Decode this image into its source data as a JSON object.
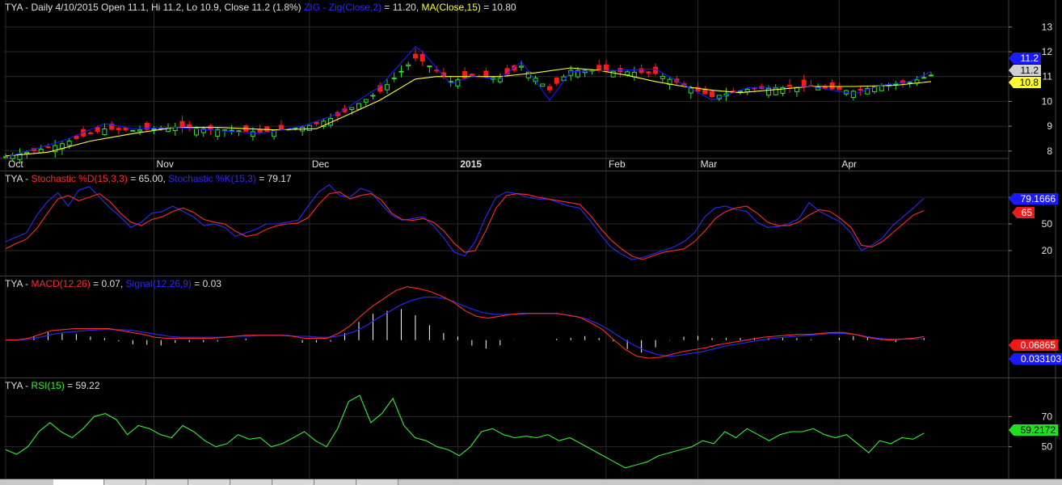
{
  "colors": {
    "bg": "#000000",
    "grid": "#2a2a2a",
    "sep": "#404040",
    "candle_up": "#33dd33",
    "candle_down": "#ff1a1a",
    "zig": "#1a1aff",
    "ma": "#ffff33",
    "stoch_d": "#ff2a2a",
    "stoch_k": "#2a2aff",
    "macd": "#ff2a2a",
    "signal": "#2a2aff",
    "hist": "#ffffff",
    "rsi": "#33ee33",
    "text": "#e0e0e0"
  },
  "price": {
    "ticker": "TYA",
    "header": " - Daily 4/10/2015 Open 11.1, Hi 11.2, Lo 10.9, Close 11.2 (1.8%)",
    "zig_label": "ZIG - Zig(Close,2)",
    "zig_value": " = 11.20, ",
    "ma_label": "MA(Close,15)",
    "ma_value": " = 10.80",
    "y_ticks": [
      "13",
      "12",
      "11",
      "10",
      "9",
      "8"
    ],
    "badge_zig": "11.2",
    "badge_close": "11.2",
    "badge_ma": "10.8",
    "x_labels": [
      {
        "t": "Oct",
        "d": 0,
        "bold": false
      },
      {
        "t": "Nov",
        "d": 21,
        "bold": false
      },
      {
        "t": "Dec",
        "d": 43,
        "bold": false
      },
      {
        "t": "2015",
        "d": 64,
        "bold": true
      },
      {
        "t": "Feb",
        "d": 85,
        "bold": false
      },
      {
        "t": "Mar",
        "d": 98,
        "bold": false
      },
      {
        "t": "Apr",
        "d": 118,
        "bold": false
      }
    ]
  },
  "stoch": {
    "ticker": "TYA",
    "d_label": "Stochastic %D(15,3,3)",
    "d_value": " = 65.00, ",
    "k_label": "Stochastic %K(15,3)",
    "k_value": " = 79.17",
    "y_ticks": [
      "80",
      "50",
      "20"
    ],
    "badge_k": "79.1666",
    "badge_d": "65"
  },
  "macd": {
    "ticker": "TYA",
    "macd_label": "MACD(12,26)",
    "macd_value": " = 0.07, ",
    "signal_label": "Signal(12,26,9)",
    "signal_value": " = 0.03",
    "badge_macd": "0.06865",
    "badge_signal": "0.033103"
  },
  "rsi": {
    "ticker": "TYA",
    "label": "RSI(15)",
    "value": " = 59.22",
    "y_ticks": [
      "70",
      "50"
    ],
    "badge": "59.2172"
  },
  "chart_data": [
    {
      "type": "candlestick",
      "title": "TYA - Daily 4/10/2015 Open 11.1, Hi 11.2, Lo 10.9, Close 11.2 (1.8%)",
      "x_range": [
        "2014-09-29",
        "2015-04-10"
      ],
      "ylim": [
        7.7,
        13.5
      ],
      "series": [
        {
          "name": "ZIG - Zig(Close,2)",
          "points": [
            [
              0,
              7.75
            ],
            [
              8,
              8.4
            ],
            [
              14,
              9.1
            ],
            [
              18,
              8.9
            ],
            [
              24,
              8.95
            ],
            [
              36,
              8.7
            ],
            [
              42,
              9.0
            ],
            [
              47,
              9.5
            ],
            [
              53,
              10.6
            ],
            [
              58,
              12.2
            ],
            [
              59,
              12.0
            ],
            [
              63,
              10.7
            ],
            [
              66,
              11.0
            ],
            [
              70,
              10.9
            ],
            [
              73,
              11.6
            ],
            [
              77,
              10.05
            ],
            [
              80,
              11.2
            ],
            [
              92,
              11.3
            ],
            [
              100,
              10.05
            ],
            [
              105,
              10.55
            ],
            [
              114,
              10.6
            ],
            [
              120,
              10.3
            ],
            [
              124,
              10.65
            ],
            [
              128,
              10.8
            ],
            [
              131,
              11.2
            ]
          ]
        },
        {
          "name": "MA(Close,15)",
          "points": [
            [
              0,
              7.8
            ],
            [
              6,
              7.95
            ],
            [
              12,
              8.4
            ],
            [
              18,
              8.7
            ],
            [
              24,
              8.95
            ],
            [
              30,
              8.95
            ],
            [
              38,
              8.85
            ],
            [
              44,
              8.9
            ],
            [
              48,
              9.4
            ],
            [
              53,
              10.05
            ],
            [
              58,
              10.9
            ],
            [
              61,
              11.0
            ],
            [
              66,
              11.0
            ],
            [
              70,
              11.0
            ],
            [
              75,
              11.15
            ],
            [
              80,
              11.35
            ],
            [
              84,
              11.25
            ],
            [
              88,
              11.05
            ],
            [
              92,
              10.8
            ],
            [
              96,
              10.6
            ],
            [
              100,
              10.45
            ],
            [
              104,
              10.35
            ],
            [
              108,
              10.45
            ],
            [
              114,
              10.6
            ],
            [
              120,
              10.6
            ],
            [
              126,
              10.65
            ],
            [
              131,
              10.8
            ]
          ]
        }
      ]
    },
    {
      "type": "line",
      "title": "TYA - Stochastic %D(15,3,3) = 65.00, Stochastic %K(15,3) = 79.17",
      "ylim": [
        0,
        100
      ],
      "series": [
        {
          "name": "Stochastic %D(15,3,3)",
          "values": [
            22,
            28,
            33,
            45,
            62,
            78,
            82,
            76,
            80,
            84,
            75,
            62,
            52,
            48,
            55,
            58,
            64,
            68,
            63,
            55,
            52,
            50,
            42,
            36,
            38,
            44,
            48,
            50,
            51,
            57,
            72,
            84,
            86,
            78,
            82,
            84,
            77,
            62,
            55,
            54,
            56,
            52,
            42,
            28,
            18,
            20,
            42,
            68,
            82,
            84,
            83,
            80,
            78,
            76,
            74,
            72,
            60,
            45,
            32,
            22,
            14,
            10,
            14,
            18,
            20,
            22,
            30,
            42,
            56,
            64,
            68,
            70,
            62,
            52,
            48,
            48,
            52,
            60,
            66,
            64,
            56,
            46,
            26,
            24,
            30,
            40,
            50,
            60,
            65
          ]
        },
        {
          "name": "Stochastic %K(15,3)",
          "values": [
            30,
            35,
            40,
            60,
            75,
            85,
            70,
            88,
            92,
            80,
            68,
            58,
            46,
            52,
            62,
            64,
            70,
            64,
            58,
            48,
            50,
            46,
            36,
            40,
            44,
            50,
            50,
            52,
            54,
            70,
            86,
            94,
            82,
            80,
            90,
            86,
            72,
            60,
            54,
            56,
            58,
            48,
            34,
            18,
            14,
            30,
            58,
            80,
            86,
            84,
            80,
            78,
            78,
            74,
            70,
            68,
            54,
            38,
            24,
            16,
            10,
            12,
            16,
            20,
            24,
            30,
            40,
            58,
            68,
            70,
            66,
            64,
            52,
            46,
            47,
            50,
            56,
            74,
            64,
            58,
            52,
            40,
            20,
            26,
            34,
            48,
            58,
            68,
            79
          ]
        }
      ]
    },
    {
      "type": "line",
      "title": "TYA - MACD(12,26) = 0.07, Signal(12,26,9) = 0.03",
      "ylim": [
        -0.7,
        1.2
      ],
      "series": [
        {
          "name": "MACD(12,26)",
          "values": [
            0,
            0,
            0.04,
            0.12,
            0.2,
            0.22,
            0.24,
            0.24,
            0.24,
            0.24,
            0.2,
            0.16,
            0.12,
            0.06,
            0.04,
            0.04,
            0.04,
            0.04,
            0.04,
            0.06,
            0.08,
            0.1,
            0.1,
            0.1,
            0.1,
            0.08,
            0.04,
            0.04,
            0.04,
            0.14,
            0.3,
            0.52,
            0.72,
            0.88,
            1.04,
            1.12,
            1.08,
            1.02,
            0.92,
            0.8,
            0.62,
            0.5,
            0.46,
            0.5,
            0.54,
            0.56,
            0.56,
            0.56,
            0.56,
            0.52,
            0.48,
            0.36,
            0.22,
            0.0,
            -0.2,
            -0.34,
            -0.38,
            -0.36,
            -0.3,
            -0.24,
            -0.2,
            -0.16,
            -0.1,
            -0.06,
            -0.02,
            0.02,
            0.06,
            0.08,
            0.1,
            0.12,
            0.12,
            0.14,
            0.16,
            0.16,
            0.12,
            0.06,
            0.02,
            0.0,
            0.02,
            0.04,
            0.07
          ]
        },
        {
          "name": "Signal(12,26,9)",
          "values": [
            0,
            0,
            0.02,
            0.06,
            0.12,
            0.16,
            0.18,
            0.2,
            0.22,
            0.22,
            0.22,
            0.2,
            0.16,
            0.12,
            0.08,
            0.06,
            0.06,
            0.06,
            0.06,
            0.06,
            0.08,
            0.08,
            0.1,
            0.1,
            0.1,
            0.08,
            0.08,
            0.06,
            0.06,
            0.1,
            0.18,
            0.3,
            0.46,
            0.6,
            0.74,
            0.84,
            0.9,
            0.9,
            0.86,
            0.76,
            0.66,
            0.58,
            0.54,
            0.54,
            0.54,
            0.56,
            0.56,
            0.56,
            0.54,
            0.5,
            0.44,
            0.34,
            0.2,
            0.04,
            -0.1,
            -0.22,
            -0.3,
            -0.34,
            -0.32,
            -0.28,
            -0.24,
            -0.18,
            -0.12,
            -0.08,
            -0.04,
            0.0,
            0.04,
            0.06,
            0.08,
            0.1,
            0.12,
            0.14,
            0.14,
            0.12,
            0.08,
            0.04,
            0.02,
            0.02,
            0.02,
            0.03
          ]
        }
      ]
    },
    {
      "type": "line",
      "title": "TYA - RSI(15) = 59.22",
      "ylim": [
        30,
        90
      ],
      "series": [
        {
          "name": "RSI(15)",
          "values": [
            48,
            45,
            50,
            60,
            66,
            60,
            56,
            62,
            70,
            72,
            68,
            58,
            64,
            62,
            58,
            56,
            64,
            60,
            54,
            50,
            52,
            58,
            55,
            56,
            50,
            52,
            56,
            60,
            54,
            50,
            62,
            80,
            84,
            66,
            72,
            82,
            64,
            56,
            54,
            50,
            48,
            44,
            50,
            60,
            62,
            58,
            56,
            57,
            56,
            58,
            54,
            56,
            52,
            48,
            44,
            40,
            36,
            38,
            40,
            44,
            46,
            48,
            50,
            54,
            52,
            60,
            56,
            62,
            58,
            54,
            58,
            60,
            60,
            62,
            58,
            56,
            58,
            52,
            46,
            54,
            52,
            56,
            55,
            59
          ]
        }
      ]
    }
  ]
}
